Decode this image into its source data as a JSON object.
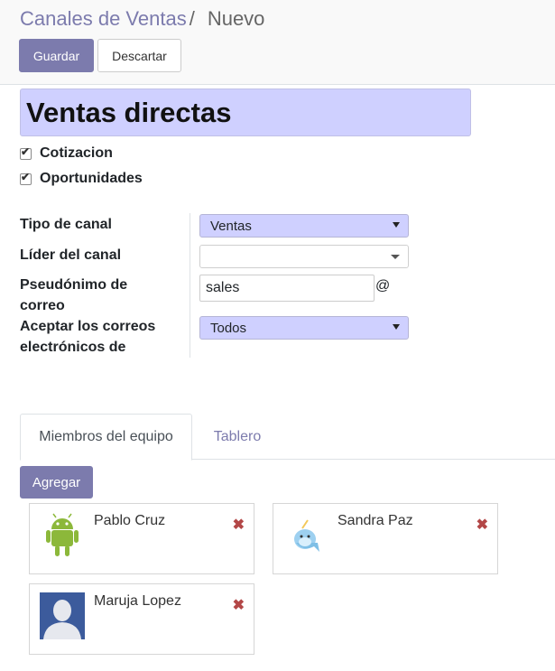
{
  "breadcrumb": {
    "parent": "Canales de Ventas",
    "separator": "/",
    "current": "Nuevo"
  },
  "toolbar": {
    "save_label": "Guardar",
    "discard_label": "Descartar"
  },
  "form": {
    "name": "Ventas directas",
    "checkboxes": [
      {
        "label": "Cotizacion",
        "checked": true
      },
      {
        "label": "Oportunidades",
        "checked": true
      }
    ],
    "fields": {
      "channel_type": {
        "label": "Tipo de canal",
        "value": "Ventas"
      },
      "channel_leader": {
        "label": "Líder del canal",
        "value": ""
      },
      "email_alias": {
        "label_line1": "Pseudónimo de",
        "label_line2": "correo",
        "value": "sales",
        "suffix": "@"
      },
      "accept_emails": {
        "label_line1": "Aceptar los correos",
        "label_line2": "electrónicos de",
        "value": "Todos"
      }
    }
  },
  "tabs": [
    {
      "label": "Miembros del equipo",
      "active": true
    },
    {
      "label": "Tablero",
      "active": false
    }
  ],
  "members": {
    "add_label": "Agregar",
    "list": [
      {
        "name": "Pablo Cruz",
        "avatar": "android-icon"
      },
      {
        "name": "Sandra Paz",
        "avatar": "narwhal-icon"
      },
      {
        "name": "Maruja Lopez",
        "avatar": "default-user-icon"
      }
    ],
    "remove_symbol": "✖"
  },
  "colors": {
    "brand": "#7c7bad",
    "required_field": "#cfd0ff",
    "remove": "#b34747"
  }
}
